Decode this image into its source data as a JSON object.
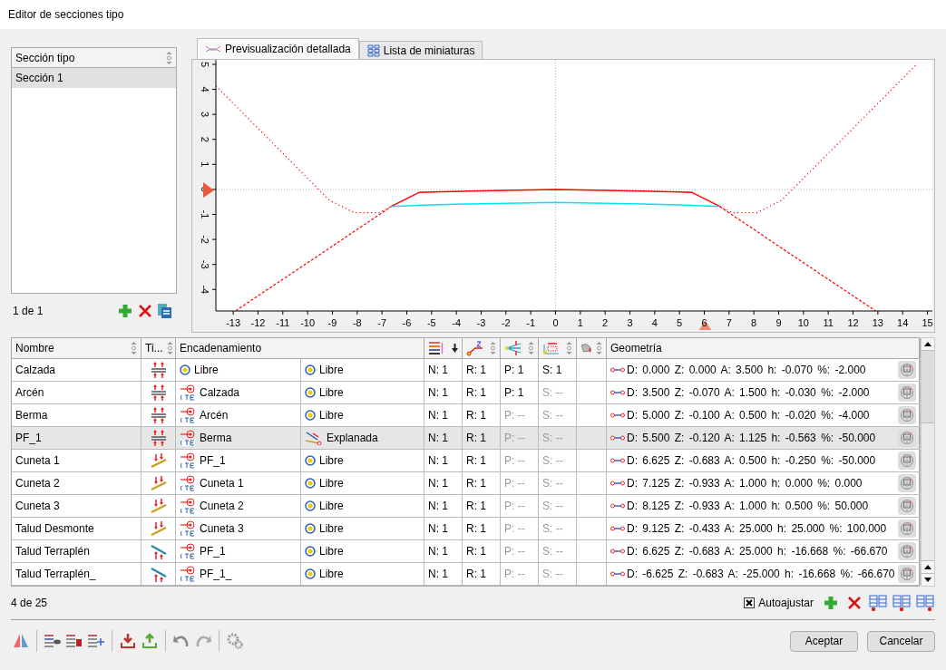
{
  "window": {
    "title": "Editor de secciones tipo"
  },
  "section_list": {
    "header": "Sección tipo",
    "items": [
      {
        "label": "Sección 1",
        "selected": true
      }
    ],
    "counter": "1 de 1"
  },
  "tabs": [
    {
      "label": "Previsualización detallada",
      "selected": true,
      "kind": "profile"
    },
    {
      "label": "Lista de miniaturas",
      "selected": false,
      "kind": "grid"
    }
  ],
  "preview": {
    "chart_data": {
      "type": "line",
      "x": [
        -13.7,
        -12.9,
        -9.125,
        -8.125,
        -7.125,
        -6.625,
        -5.5,
        -5,
        -3.5,
        0,
        3.5,
        5,
        5.5,
        6.625,
        7.125,
        8.125,
        9.125,
        12.9,
        13.7,
        14.6
      ],
      "series": [
        {
          "color": "#ff0000",
          "line_style": "solid",
          "values": [
            null,
            null,
            null,
            null,
            null,
            -0.68,
            -0.12,
            -0.1,
            -0.07,
            0,
            -0.07,
            -0.1,
            -0.12,
            -0.68,
            null,
            null,
            null,
            null,
            null,
            null
          ]
        },
        {
          "color": "#00e5ee",
          "line_style": "solid",
          "values": [
            null,
            null,
            null,
            null,
            null,
            -0.68,
            -0.64,
            -0.62,
            -0.58,
            -0.52,
            -0.58,
            -0.62,
            -0.64,
            -0.68,
            null,
            null,
            null,
            null,
            null,
            null
          ]
        },
        {
          "color": "#ff0000",
          "line_style": "dotted",
          "values": [
            4.14,
            3.34,
            -0.43,
            -0.93,
            -0.93,
            -0.68,
            null,
            null,
            null,
            null,
            null,
            null,
            null,
            -0.68,
            -0.93,
            -0.93,
            -0.43,
            3.34,
            4.14,
            5.04
          ]
        },
        {
          "color": "#ff0000",
          "line_style": "dashed",
          "values": [
            null,
            -4.85,
            -2.35,
            -1.68,
            -1.02,
            -0.68,
            null,
            null,
            null,
            null,
            null,
            null,
            null,
            -0.68,
            -1.02,
            -1.68,
            -2.35,
            -4.85,
            null,
            null
          ]
        }
      ],
      "xlim": [
        -13.7,
        15.2
      ],
      "ylim": [
        -4.86,
        5.18
      ],
      "xticks": [
        -13,
        -12,
        -11,
        -10,
        -9,
        -8,
        -7,
        -6,
        -5,
        -4,
        -3,
        -2,
        -1,
        0,
        1,
        2,
        3,
        4,
        5,
        6,
        7,
        8,
        9,
        10,
        11,
        12,
        13,
        14,
        15
      ],
      "yticks": [
        -4,
        -3,
        -2,
        -1,
        0,
        1,
        2,
        3,
        4,
        5
      ]
    }
  },
  "table": {
    "columns": [
      {
        "label": "Nombre",
        "sortable": true,
        "sorted": false
      },
      {
        "label": "Ti...",
        "sortable": true,
        "sorted": false
      },
      {
        "label": "Encadenamiento",
        "sortable": false,
        "sorted": false
      },
      {
        "kind": "layers",
        "sortable": false,
        "sorted": true
      },
      {
        "kind": "elevation",
        "sortable": true,
        "sorted": false
      },
      {
        "kind": "slope",
        "sortable": true,
        "sorted": false
      },
      {
        "kind": "offset",
        "sortable": true,
        "sorted": false
      },
      {
        "kind": "tag",
        "sortable": true,
        "sorted": false
      },
      {
        "label": "Geometría",
        "sortable": false,
        "sorted": false
      }
    ],
    "rows": [
      {
        "name": "Calzada",
        "kind": "platform",
        "link": {
          "kind": "free",
          "label": "Libre"
        },
        "link2": {
          "kind": "free",
          "label": "Libre"
        },
        "n": "N: 1",
        "r": "R: 1",
        "p": {
          "text": "P: 1",
          "disabled": false
        },
        "s": {
          "text": "S: 1",
          "disabled": false
        },
        "geometry": "D: 0.000 Z: 0.000 A: 3.500 h: -0.070 %: -2.000",
        "selected": false
      },
      {
        "name": "Arcén",
        "kind": "platform",
        "link": {
          "kind": "chain",
          "label": "Calzada"
        },
        "link2": {
          "kind": "free",
          "label": "Libre"
        },
        "n": "N: 1",
        "r": "R: 1",
        "p": {
          "text": "P: 1",
          "disabled": false
        },
        "s": {
          "text": "S: --",
          "disabled": true
        },
        "geometry": "D: 3.500 Z: -0.070 A: 1.500 h: -0.030 %: -2.000",
        "selected": false
      },
      {
        "name": "Berma",
        "kind": "platform",
        "link": {
          "kind": "chain",
          "label": "Arcén"
        },
        "link2": {
          "kind": "free",
          "label": "Libre"
        },
        "n": "N: 1",
        "r": "R: 1",
        "p": {
          "text": "P: --",
          "disabled": true
        },
        "s": {
          "text": "S: --",
          "disabled": true
        },
        "geometry": "D: 5.000 Z: -0.100 A: 0.500 h: -0.020 %: -4.000",
        "selected": false
      },
      {
        "name": "PF_1",
        "kind": "platform",
        "link": {
          "kind": "chain",
          "label": "Berma"
        },
        "link2": {
          "kind": "subgrade",
          "label": "Explanada"
        },
        "n": "N: 1",
        "r": "R: 1",
        "p": {
          "text": "P: --",
          "disabled": true
        },
        "s": {
          "text": "S: --",
          "disabled": true
        },
        "geometry": "D: 5.500 Z: -0.120 A: 1.125 h: -0.563 %: -50.000",
        "selected": true
      },
      {
        "name": "Cuneta 1",
        "kind": "ditch",
        "link": {
          "kind": "chain",
          "label": "PF_1"
        },
        "link2": {
          "kind": "free",
          "label": "Libre"
        },
        "n": "N: 1",
        "r": "R: 1",
        "p": {
          "text": "P: --",
          "disabled": true
        },
        "s": {
          "text": "S: --",
          "disabled": true
        },
        "geometry": "D: 6.625 Z: -0.683 A: 0.500 h: -0.250 %: -50.000",
        "selected": false
      },
      {
        "name": "Cuneta 2",
        "kind": "ditch",
        "link": {
          "kind": "chain",
          "label": "Cuneta 1"
        },
        "link2": {
          "kind": "free",
          "label": "Libre"
        },
        "n": "N: 1",
        "r": "R: 1",
        "p": {
          "text": "P: --",
          "disabled": true
        },
        "s": {
          "text": "S: --",
          "disabled": true
        },
        "geometry": "D: 7.125 Z: -0.933 A: 1.000 h: 0.000 %: 0.000",
        "selected": false
      },
      {
        "name": "Cuneta 3",
        "kind": "ditch",
        "link": {
          "kind": "chain",
          "label": "Cuneta 2"
        },
        "link2": {
          "kind": "free",
          "label": "Libre"
        },
        "n": "N: 1",
        "r": "R: 1",
        "p": {
          "text": "P: --",
          "disabled": true
        },
        "s": {
          "text": "S: --",
          "disabled": true
        },
        "geometry": "D: 8.125 Z: -0.933 A: 1.000 h: 0.500 %: 50.000",
        "selected": false
      },
      {
        "name": "Talud Desmonte",
        "kind": "ditch",
        "link": {
          "kind": "chain",
          "label": "Cuneta 3"
        },
        "link2": {
          "kind": "free",
          "label": "Libre"
        },
        "n": "N: 1",
        "r": "R: 1",
        "p": {
          "text": "P: --",
          "disabled": true
        },
        "s": {
          "text": "S: --",
          "disabled": true
        },
        "geometry": "D: 9.125 Z: -0.433 A: 25.000 h: 25.000 %: 100.000",
        "selected": false
      },
      {
        "name": "Talud Terraplén",
        "kind": "embankment",
        "link": {
          "kind": "chain",
          "label": "PF_1"
        },
        "link2": {
          "kind": "free",
          "label": "Libre"
        },
        "n": "N: 1",
        "r": "R: 1",
        "p": {
          "text": "P: --",
          "disabled": true
        },
        "s": {
          "text": "S: --",
          "disabled": true
        },
        "geometry": "D: 6.625 Z: -0.683 A: 25.000 h: -16.668 %: -66.670",
        "selected": false
      },
      {
        "name": "Talud Terraplén_",
        "kind": "embankment",
        "link": {
          "kind": "chain",
          "label": "PF_1_"
        },
        "link2": {
          "kind": "free",
          "label": "Libre"
        },
        "n": "N: 1",
        "r": "R: 1",
        "p": {
          "text": "P: --",
          "disabled": true
        },
        "s": {
          "text": "S: --",
          "disabled": true
        },
        "geometry": "D: -6.625 Z: -0.683 A: -25.000 h: -16.668 %: -66.670",
        "selected": false
      }
    ]
  },
  "footer": {
    "counter": "4 de 25",
    "autofit": {
      "label": "Autoajustar",
      "checked": true
    }
  },
  "buttons": [
    "Aceptar",
    "Cancelar"
  ]
}
